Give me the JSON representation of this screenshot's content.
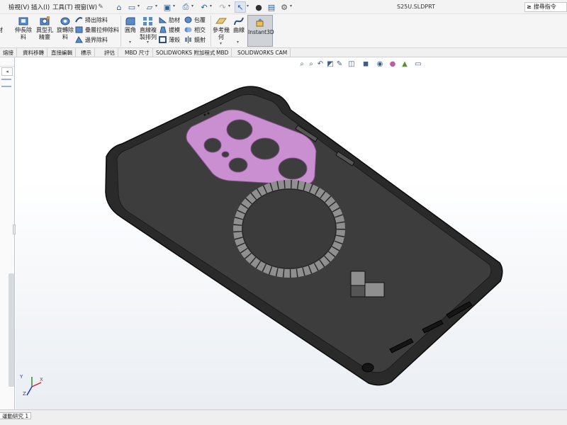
{
  "menu": {
    "items": [
      "檢視(V)",
      "插入(I)",
      "工具(T)",
      "視窗(W)"
    ],
    "pin_icon": "pin-icon"
  },
  "quick_access": {
    "icons": [
      "home-icon",
      "new-document-icon",
      "open-icon",
      "save-icon",
      "print-icon",
      "undo-icon",
      "redo-icon",
      "select-icon",
      "rebuild-icon",
      "file-properties-icon",
      "options-icon"
    ]
  },
  "document": {
    "title": "S25U.SLDPRT"
  },
  "search": {
    "prompt_symbol": "≥",
    "placeholder": "搜尋指令"
  },
  "ribbon": {
    "left_cut_label": "材",
    "big_buttons": [
      {
        "name": "extruded-cut",
        "label_l1": "伸長除",
        "label_l2": "料"
      },
      {
        "name": "hole-wizard",
        "label_l1": "異型孔",
        "label_l2": "精靈"
      },
      {
        "name": "revolved-cut",
        "label_l1": "旋轉除",
        "label_l2": "料"
      }
    ],
    "cut_small": [
      {
        "name": "swept-cut",
        "label": "掃出除料"
      },
      {
        "name": "lofted-cut",
        "label": "疊層拉伸除料"
      },
      {
        "name": "boundary-cut",
        "label": "邊界除料"
      }
    ],
    "fillet": {
      "label": "圓角"
    },
    "linear_pattern": {
      "label_l1": "直線複",
      "label_l2": "製排列"
    },
    "features_small": [
      {
        "name": "rib",
        "label": "肋材"
      },
      {
        "name": "draft",
        "label": "拔模"
      },
      {
        "name": "shell",
        "label": "薄殼"
      }
    ],
    "features_small2": [
      {
        "name": "wrap",
        "label": "包覆"
      },
      {
        "name": "intersect",
        "label": "相交"
      },
      {
        "name": "mirror",
        "label": "鏡射"
      }
    ],
    "ref_geometry": {
      "label_l1": "參考幾",
      "label_l2": "何"
    },
    "curves": {
      "label": "曲線"
    },
    "instant3d": {
      "label": "Instant3D"
    }
  },
  "tabs": [
    "熔接",
    "資料移轉",
    "直接編輯",
    "標示",
    "評估",
    "MBD 尺寸",
    "SOLIDWORKS 附加程式",
    "MBD",
    "SOLIDWORKS CAM"
  ],
  "hud_icons": [
    "zoom-to-fit-icon",
    "zoom-to-area-icon",
    "previous-view-icon",
    "section-view-icon",
    "dynamic-annotation-icon",
    "view-orientation-icon",
    "display-style-icon",
    "hide-show-items-icon",
    "edit-appearance-icon",
    "apply-scene-icon",
    "view-settings-icon"
  ],
  "triad": {
    "x": "X",
    "y": "Y",
    "z": "Z"
  },
  "status": {
    "study_tab": "運動研究 1"
  },
  "colors": {
    "case_body": "#3b3b3b",
    "case_edge": "#111111",
    "camera_plate": "#c98fd1",
    "magsafe_ring": "#8f8f8f",
    "viewport_bottom": "#eaeef3"
  }
}
